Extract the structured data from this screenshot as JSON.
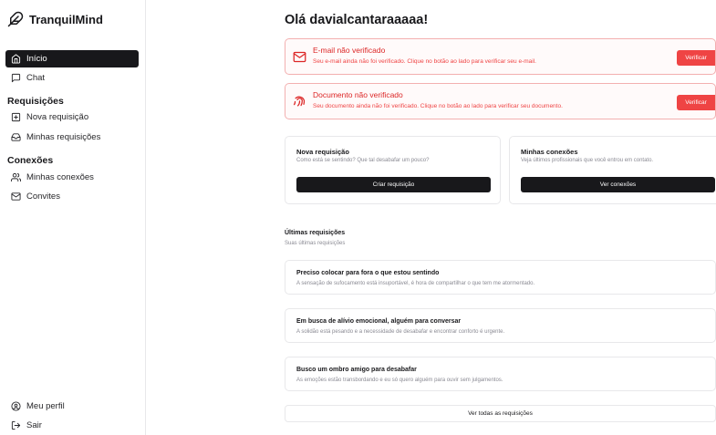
{
  "brand": {
    "name": "TranquilMind",
    "icon": "feather-icon"
  },
  "sidebar": {
    "items": [
      {
        "label": "Início",
        "icon": "home-icon",
        "active": true
      },
      {
        "label": "Chat",
        "icon": "message-square-icon"
      }
    ],
    "sections": [
      {
        "title": "Requisições",
        "items": [
          {
            "label": "Nova requisição",
            "icon": "file-plus-icon"
          },
          {
            "label": "Minhas requisições",
            "icon": "inbox-icon"
          }
        ]
      },
      {
        "title": "Conexões",
        "items": [
          {
            "label": "Minhas conexões",
            "icon": "users-icon"
          },
          {
            "label": "Convites",
            "icon": "mail-icon"
          }
        ]
      }
    ],
    "footer": [
      {
        "label": "Meu perfil",
        "icon": "user-circle-icon"
      },
      {
        "label": "Sair",
        "icon": "log-out-icon"
      }
    ]
  },
  "main": {
    "greeting": "Olá davialcantaraaaaa!",
    "alerts": [
      {
        "title": "E-mail não verificado",
        "description": "Seu e-mail ainda não foi verificado. Clique no botão ao lado para verificar seu e-mail.",
        "button": "Verificar",
        "icon": "mail-icon"
      },
      {
        "title": "Documento não verificado",
        "description": "Seu documento ainda não foi verificado. Clique no botão ao lado para verificar seu documento.",
        "button": "Verificar",
        "icon": "fingerprint-icon"
      }
    ],
    "cards": [
      {
        "title": "Nova requisição",
        "description": "Como está se sentindo? Que tal desabafar um pouco?",
        "button": "Criar requisição"
      },
      {
        "title": "Minhas conexões",
        "description": "Veja últimos profissionais que você entrou em contato.",
        "button": "Ver conexões"
      }
    ],
    "recent": {
      "title": "Últimas requisições",
      "subtitle": "Suas últimas requisições",
      "items": [
        {
          "title": "Preciso colocar para fora o que estou sentindo",
          "description": "A sensação de sufocamento está insuportável, é hora de compartilhar o que tem me atormentado."
        },
        {
          "title": "Em busca de alívio emocional, alguém para conversar",
          "description": "A solidão está pesando e a necessidade de desabafar e encontrar conforto é urgente."
        },
        {
          "title": "Busco um ombro amigo para desabafar",
          "description": "As emoções estão transbordando e eu só quero alguém para ouvir sem julgamentos."
        }
      ],
      "see_all": "Ver todas as requisições"
    }
  },
  "colors": {
    "primary": "#18181b",
    "danger": "#ef4444",
    "danger_text": "#dc2626",
    "danger_border": "#f3b0b0",
    "muted_text": "#8a8a93",
    "border": "#e8e8ea"
  }
}
